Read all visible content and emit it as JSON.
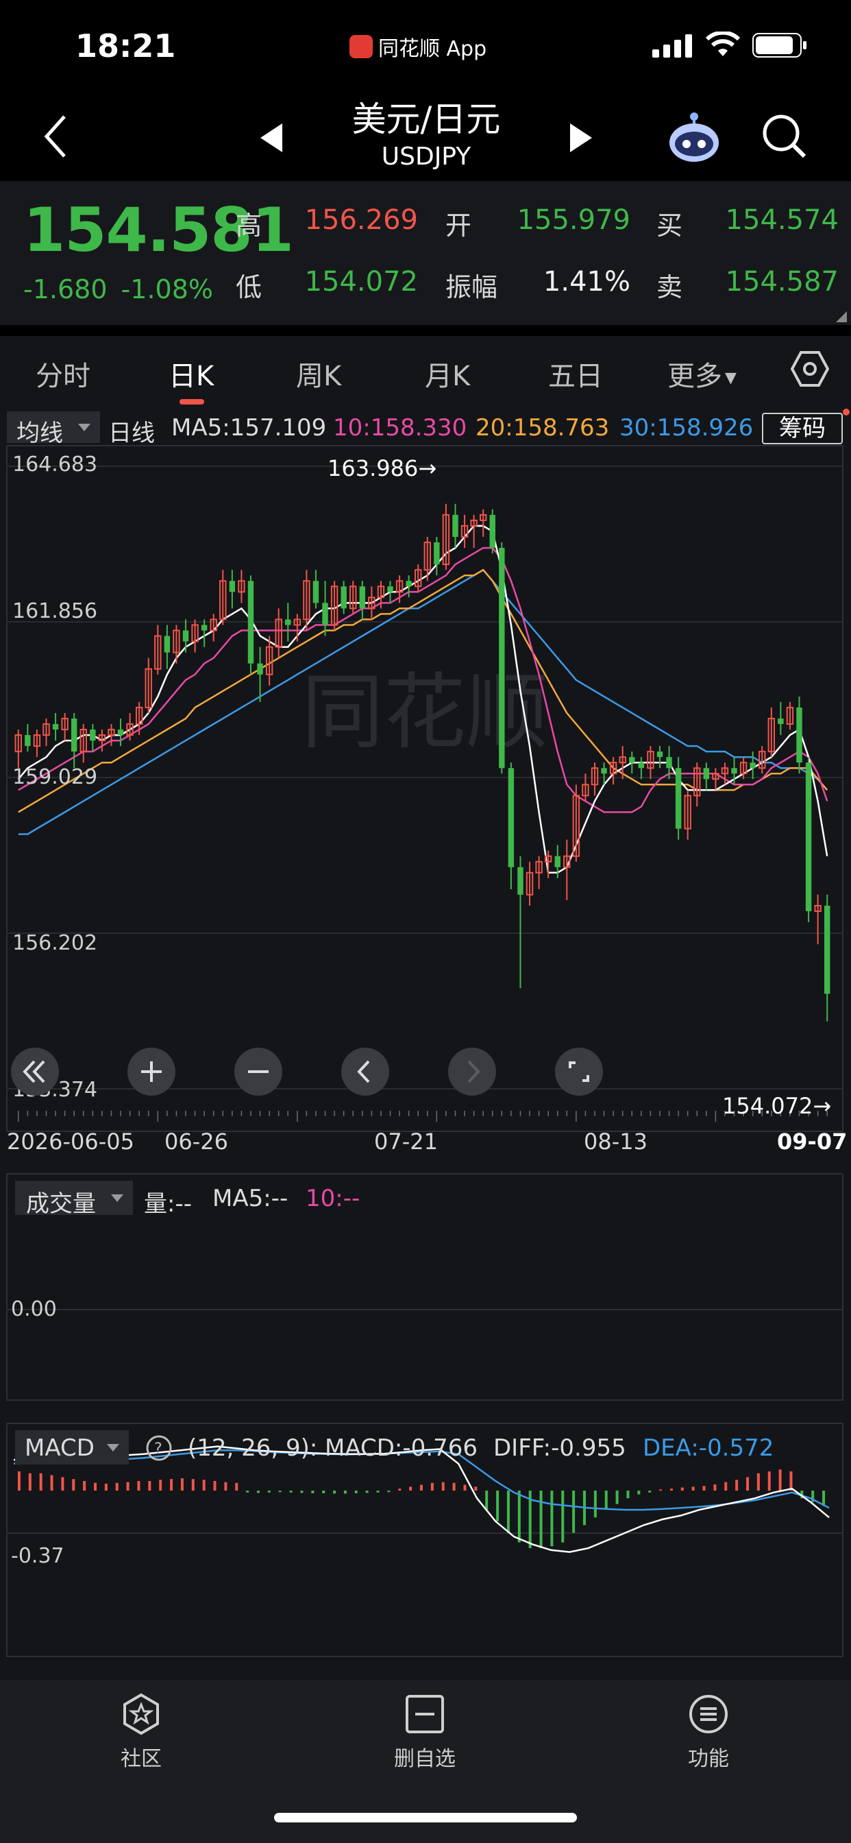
{
  "status_bar": {
    "time": "18:21",
    "app_name": "同花顺 App"
  },
  "nav": {
    "title": "美元/日元",
    "subtitle": "USDJPY"
  },
  "quote": {
    "price": "154.581",
    "change": "-1.680",
    "change_pct": "-1.08%",
    "high_label": "高",
    "high": "156.269",
    "open_label": "开",
    "open": "155.979",
    "buy_label": "买",
    "buy": "154.574",
    "low_label": "低",
    "low": "154.072",
    "amp_label": "振幅",
    "amplitude": "1.41%",
    "sell_label": "卖",
    "sell": "154.587"
  },
  "tabs": [
    "分时",
    "日K",
    "周K",
    "月K",
    "五日",
    "更多"
  ],
  "active_tab": "日K",
  "ma_legend": {
    "selector": "均线",
    "period_label": "日线",
    "ma5": "MA5:157.109",
    "ma10": "10:158.330",
    "ma20": "20:158.763",
    "ma30": "30:158.926",
    "chip_button": "筹码"
  },
  "colors": {
    "up": "#f1554a",
    "down": "#3fb84a",
    "ma5": "#ffffff",
    "ma10": "#e84aa6",
    "ma20": "#f3a93c",
    "ma30": "#3b9be8"
  },
  "kline_labels": {
    "y_ticks": [
      "164.683",
      "161.856",
      "159.029",
      "156.202",
      "153.374"
    ],
    "max_marker": "163.986→",
    "min_marker": "154.072→",
    "dates": [
      "2026-06-05",
      "06-26",
      "07-21",
      "08-13",
      "09-07"
    ]
  },
  "chart_data": {
    "type": "candlestick",
    "ylim": [
      153.374,
      164.683
    ],
    "y_ticks": [
      164.683,
      161.856,
      159.029,
      156.202,
      153.374
    ],
    "x_tick_labels": [
      "2026-06-05",
      "06-26",
      "07-21",
      "08-13",
      "09-07"
    ],
    "max_value": 163.986,
    "min_value": 154.072,
    "candles_ohlc": [
      [
        159.5,
        159.9,
        159.2,
        159.8
      ],
      [
        159.8,
        160.0,
        159.5,
        159.6
      ],
      [
        159.6,
        159.9,
        159.4,
        159.8
      ],
      [
        159.8,
        160.1,
        159.6,
        160.0
      ],
      [
        160.0,
        160.2,
        159.7,
        159.9
      ],
      [
        159.9,
        160.2,
        159.7,
        160.1
      ],
      [
        160.1,
        160.2,
        159.2,
        159.5
      ],
      [
        159.5,
        160.0,
        159.3,
        159.9
      ],
      [
        159.9,
        160.0,
        159.5,
        159.7
      ],
      [
        159.7,
        159.9,
        159.5,
        159.8
      ],
      [
        159.8,
        160.0,
        159.6,
        159.9
      ],
      [
        159.9,
        160.1,
        159.6,
        159.8
      ],
      [
        159.8,
        160.2,
        159.7,
        160.0
      ],
      [
        160.0,
        160.4,
        159.8,
        160.3
      ],
      [
        160.3,
        161.2,
        160.2,
        161.0
      ],
      [
        161.0,
        161.8,
        160.9,
        161.6
      ],
      [
        161.6,
        161.8,
        161.0,
        161.3
      ],
      [
        161.3,
        161.8,
        161.1,
        161.7
      ],
      [
        161.7,
        161.9,
        161.3,
        161.5
      ],
      [
        161.5,
        161.9,
        161.3,
        161.8
      ],
      [
        161.8,
        161.9,
        161.4,
        161.7
      ],
      [
        161.7,
        162.0,
        161.5,
        161.9
      ],
      [
        161.9,
        162.8,
        161.8,
        162.6
      ],
      [
        162.6,
        162.8,
        162.1,
        162.4
      ],
      [
        162.4,
        162.8,
        162.2,
        162.6
      ],
      [
        162.6,
        162.7,
        160.9,
        161.1
      ],
      [
        161.1,
        161.4,
        160.4,
        160.9
      ],
      [
        160.9,
        161.6,
        160.7,
        161.4
      ],
      [
        161.4,
        162.1,
        161.2,
        161.9
      ],
      [
        161.9,
        162.2,
        161.5,
        161.8
      ],
      [
        161.8,
        162.0,
        161.5,
        161.9
      ],
      [
        161.9,
        162.8,
        161.7,
        162.6
      ],
      [
        162.6,
        162.8,
        162.1,
        162.2
      ],
      [
        162.2,
        162.6,
        161.6,
        161.8
      ],
      [
        161.8,
        162.6,
        161.7,
        162.5
      ],
      [
        162.5,
        162.6,
        162.0,
        162.1
      ],
      [
        162.1,
        162.6,
        162.0,
        162.5
      ],
      [
        162.5,
        162.6,
        161.9,
        162.1
      ],
      [
        162.1,
        162.5,
        161.9,
        162.3
      ],
      [
        162.3,
        162.6,
        162.1,
        162.5
      ],
      [
        162.5,
        162.6,
        162.2,
        162.4
      ],
      [
        162.4,
        162.7,
        162.2,
        162.6
      ],
      [
        162.6,
        162.7,
        162.3,
        162.5
      ],
      [
        162.5,
        162.9,
        162.4,
        162.8
      ],
      [
        162.8,
        163.4,
        162.6,
        163.3
      ],
      [
        163.3,
        163.4,
        162.7,
        162.9
      ],
      [
        162.9,
        164.0,
        162.8,
        163.8
      ],
      [
        163.8,
        164.0,
        163.2,
        163.4
      ],
      [
        163.4,
        163.8,
        163.2,
        163.6
      ],
      [
        163.6,
        163.8,
        163.2,
        163.7
      ],
      [
        163.7,
        163.9,
        163.4,
        163.8
      ],
      [
        163.8,
        163.9,
        163.1,
        163.2
      ],
      [
        163.2,
        163.3,
        159.1,
        159.2
      ],
      [
        159.2,
        159.3,
        157.0,
        157.4
      ],
      [
        157.4,
        157.6,
        155.2,
        156.9
      ],
      [
        156.9,
        157.5,
        156.7,
        157.3
      ],
      [
        157.3,
        157.6,
        157.0,
        157.5
      ],
      [
        157.5,
        157.7,
        157.2,
        157.6
      ],
      [
        157.6,
        157.8,
        157.2,
        157.4
      ],
      [
        157.4,
        157.9,
        156.8,
        157.6
      ],
      [
        157.6,
        158.9,
        157.5,
        158.7
      ],
      [
        158.7,
        159.1,
        158.6,
        158.9
      ],
      [
        158.9,
        159.3,
        158.7,
        159.2
      ],
      [
        159.2,
        159.3,
        158.9,
        159.1
      ],
      [
        159.1,
        159.4,
        158.9,
        159.3
      ],
      [
        159.3,
        159.6,
        159.0,
        159.4
      ],
      [
        159.4,
        159.5,
        159.1,
        159.3
      ],
      [
        159.3,
        159.4,
        159.0,
        159.2
      ],
      [
        159.2,
        159.6,
        159.0,
        159.5
      ],
      [
        159.5,
        159.6,
        159.2,
        159.4
      ],
      [
        159.4,
        159.6,
        159.0,
        159.2
      ],
      [
        159.2,
        159.4,
        157.9,
        158.1
      ],
      [
        158.1,
        158.8,
        157.9,
        158.7
      ],
      [
        158.7,
        159.3,
        158.5,
        159.2
      ],
      [
        159.2,
        159.3,
        158.8,
        159.0
      ],
      [
        159.0,
        159.2,
        158.8,
        159.1
      ],
      [
        159.1,
        159.3,
        158.9,
        159.2
      ],
      [
        159.2,
        159.4,
        158.9,
        159.1
      ],
      [
        159.1,
        159.4,
        159.0,
        159.3
      ],
      [
        159.3,
        159.5,
        159.0,
        159.2
      ],
      [
        159.2,
        159.6,
        159.1,
        159.5
      ],
      [
        159.5,
        160.3,
        159.4,
        160.1
      ],
      [
        160.1,
        160.4,
        159.8,
        160.0
      ],
      [
        160.0,
        160.4,
        159.9,
        160.3
      ],
      [
        160.3,
        160.5,
        159.1,
        159.3
      ],
      [
        159.3,
        159.4,
        156.4,
        156.6
      ],
      [
        156.6,
        156.9,
        156.0,
        156.7
      ],
      [
        156.7,
        156.9,
        154.6,
        155.1
      ]
    ],
    "ma5": [
      159.0,
      159.2,
      159.3,
      159.4,
      159.6,
      159.7,
      159.7,
      159.8,
      159.8,
      159.7,
      159.8,
      159.8,
      159.9,
      160.0,
      160.2,
      160.5,
      160.9,
      161.2,
      161.4,
      161.5,
      161.6,
      161.7,
      161.9,
      162.0,
      162.1,
      161.9,
      161.6,
      161.5,
      161.4,
      161.4,
      161.6,
      161.8,
      162.0,
      162.1,
      162.1,
      162.2,
      162.2,
      162.2,
      162.2,
      162.3,
      162.4,
      162.4,
      162.5,
      162.6,
      162.7,
      162.9,
      163.1,
      163.2,
      163.4,
      163.6,
      163.6,
      163.5,
      162.8,
      161.8,
      160.6,
      159.6,
      158.4,
      157.3,
      157.3,
      157.4,
      157.8,
      158.2,
      158.6,
      158.9,
      159.1,
      159.2,
      159.3,
      159.3,
      159.3,
      159.3,
      159.3,
      159.0,
      158.8,
      158.8,
      158.8,
      158.8,
      158.9,
      159.0,
      159.1,
      159.2,
      159.3,
      159.4,
      159.6,
      159.8,
      159.9,
      159.4,
      158.6,
      157.6
    ],
    "ma10": [
      158.8,
      158.9,
      159.0,
      159.1,
      159.2,
      159.3,
      159.4,
      159.5,
      159.5,
      159.6,
      159.7,
      159.7,
      159.8,
      159.9,
      160.0,
      160.2,
      160.4,
      160.6,
      160.8,
      160.9,
      161.1,
      161.2,
      161.4,
      161.6,
      161.7,
      161.7,
      161.7,
      161.7,
      161.7,
      161.7,
      161.7,
      161.7,
      161.8,
      161.8,
      161.8,
      161.9,
      162.0,
      162.1,
      162.1,
      162.2,
      162.2,
      162.3,
      162.4,
      162.4,
      162.5,
      162.6,
      162.7,
      162.9,
      163.0,
      163.1,
      163.2,
      163.2,
      163.0,
      162.6,
      162.1,
      161.5,
      160.9,
      160.2,
      159.5,
      158.9,
      158.7,
      158.6,
      158.5,
      158.4,
      158.4,
      158.4,
      158.4,
      158.5,
      158.8,
      159.0,
      159.1,
      159.1,
      159.1,
      159.1,
      159.1,
      159.1,
      159.0,
      158.9,
      158.9,
      158.9,
      159.0,
      159.2,
      159.3,
      159.4,
      159.5,
      159.4,
      159.1,
      158.6
    ],
    "ma20": [
      158.4,
      158.5,
      158.6,
      158.7,
      158.8,
      158.9,
      159.0,
      159.1,
      159.2,
      159.3,
      159.3,
      159.4,
      159.5,
      159.6,
      159.7,
      159.8,
      159.9,
      160.0,
      160.1,
      160.3,
      160.4,
      160.5,
      160.6,
      160.7,
      160.8,
      160.9,
      161.0,
      161.1,
      161.2,
      161.3,
      161.4,
      161.5,
      161.6,
      161.7,
      161.7,
      161.8,
      161.8,
      161.9,
      161.9,
      162.0,
      162.0,
      162.1,
      162.1,
      162.2,
      162.3,
      162.4,
      162.5,
      162.6,
      162.7,
      162.7,
      162.8,
      162.6,
      162.3,
      162.0,
      161.7,
      161.4,
      161.1,
      160.8,
      160.5,
      160.2,
      160.0,
      159.8,
      159.6,
      159.4,
      159.2,
      159.1,
      159.0,
      158.9,
      158.9,
      158.9,
      158.9,
      158.9,
      158.9,
      158.8,
      158.8,
      158.8,
      158.8,
      158.8,
      158.9,
      158.9,
      159.0,
      159.1,
      159.1,
      159.2,
      159.2,
      159.2,
      159.0,
      158.8
    ],
    "ma30": [
      158.0,
      158.0,
      158.1,
      158.2,
      158.3,
      158.4,
      158.5,
      158.6,
      158.7,
      158.8,
      158.9,
      159.0,
      159.1,
      159.2,
      159.3,
      159.4,
      159.5,
      159.6,
      159.7,
      159.8,
      159.9,
      160.0,
      160.1,
      160.2,
      160.3,
      160.4,
      160.5,
      160.6,
      160.7,
      160.8,
      160.9,
      161.0,
      161.1,
      161.2,
      161.3,
      161.4,
      161.5,
      161.6,
      161.7,
      161.8,
      161.9,
      162.0,
      162.1,
      162.1,
      162.2,
      162.3,
      162.4,
      162.5,
      162.6,
      162.7,
      162.8,
      162.6,
      162.4,
      162.2,
      162.0,
      161.8,
      161.6,
      161.4,
      161.2,
      161.0,
      160.8,
      160.7,
      160.6,
      160.5,
      160.4,
      160.3,
      160.2,
      160.1,
      160.0,
      159.9,
      159.8,
      159.7,
      159.6,
      159.6,
      159.5,
      159.5,
      159.5,
      159.4,
      159.4,
      159.4,
      159.3,
      159.3,
      159.2,
      159.2,
      159.2,
      159.1,
      159.0,
      158.8
    ]
  },
  "volume": {
    "selector": "成交量",
    "vol": "量:--",
    "ma5": "MA5:--",
    "ma10": "10:--",
    "zero_label": "0.00"
  },
  "macd": {
    "selector": "MACD",
    "params": "(12, 26, 9):",
    "macd": "MACD:-0.766",
    "diff": "DIFF:-0.955",
    "dea": "DEA:-0.572",
    "y_label": "-0.37",
    "hist": [
      0.5,
      0.45,
      0.45,
      0.4,
      0.35,
      0.3,
      0.25,
      0.2,
      0.18,
      0.2,
      0.22,
      0.25,
      0.25,
      0.28,
      0.3,
      0.32,
      0.3,
      0.28,
      0.25,
      0.22,
      0.2,
      -0.05,
      -0.06,
      -0.05,
      -0.04,
      -0.05,
      -0.06,
      -0.07,
      -0.07,
      -0.08,
      -0.08,
      -0.07,
      -0.06,
      -0.05,
      -0.04,
      0.05,
      0.1,
      0.15,
      0.2,
      0.22,
      0.2,
      0.15,
      0.1,
      -0.5,
      -0.8,
      -1.1,
      -1.35,
      -1.5,
      -1.5,
      -1.45,
      -1.35,
      -1.1,
      -0.9,
      -0.7,
      -0.5,
      -0.35,
      -0.2,
      -0.1,
      -0.05,
      0.03,
      0.05,
      0.08,
      0.1,
      0.12,
      0.16,
      0.22,
      0.28,
      0.35,
      0.45,
      0.5,
      0.55,
      0.5,
      -0.2,
      -0.3,
      -0.4
    ],
    "diff_line": [
      0.8,
      0.85,
      0.85,
      0.9,
      0.9,
      0.92,
      0.92,
      0.95,
      1.0,
      1.05,
      1.1,
      1.15,
      1.1,
      1.05,
      1.02,
      1.0,
      0.98,
      0.96,
      0.95,
      0.95,
      0.96,
      1.0,
      1.05,
      1.08,
      0.7,
      -0.2,
      -0.8,
      -1.2,
      -1.4,
      -1.55,
      -1.6,
      -1.5,
      -1.3,
      -1.1,
      -0.9,
      -0.75,
      -0.65,
      -0.5,
      -0.4,
      -0.3,
      -0.2,
      -0.05,
      0.05,
      -0.3,
      -0.7
    ],
    "dea_line": [
      0.7,
      0.72,
      0.74,
      0.76,
      0.78,
      0.8,
      0.82,
      0.85,
      0.9,
      0.95,
      1.0,
      1.05,
      1.05,
      1.03,
      1.0,
      0.98,
      0.96,
      0.95,
      0.94,
      0.95,
      0.96,
      0.98,
      1.0,
      1.02,
      0.95,
      0.6,
      0.25,
      -0.05,
      -0.25,
      -0.35,
      -0.4,
      -0.45,
      -0.48,
      -0.5,
      -0.5,
      -0.48,
      -0.45,
      -0.42,
      -0.38,
      -0.32,
      -0.25,
      -0.15,
      -0.05,
      -0.2,
      -0.45
    ]
  },
  "bottom_nav": [
    {
      "label": "社区",
      "icon": "community-star-icon"
    },
    {
      "label": "删自选",
      "icon": "remove-watchlist-icon"
    },
    {
      "label": "功能",
      "icon": "menu-lines-icon"
    }
  ]
}
